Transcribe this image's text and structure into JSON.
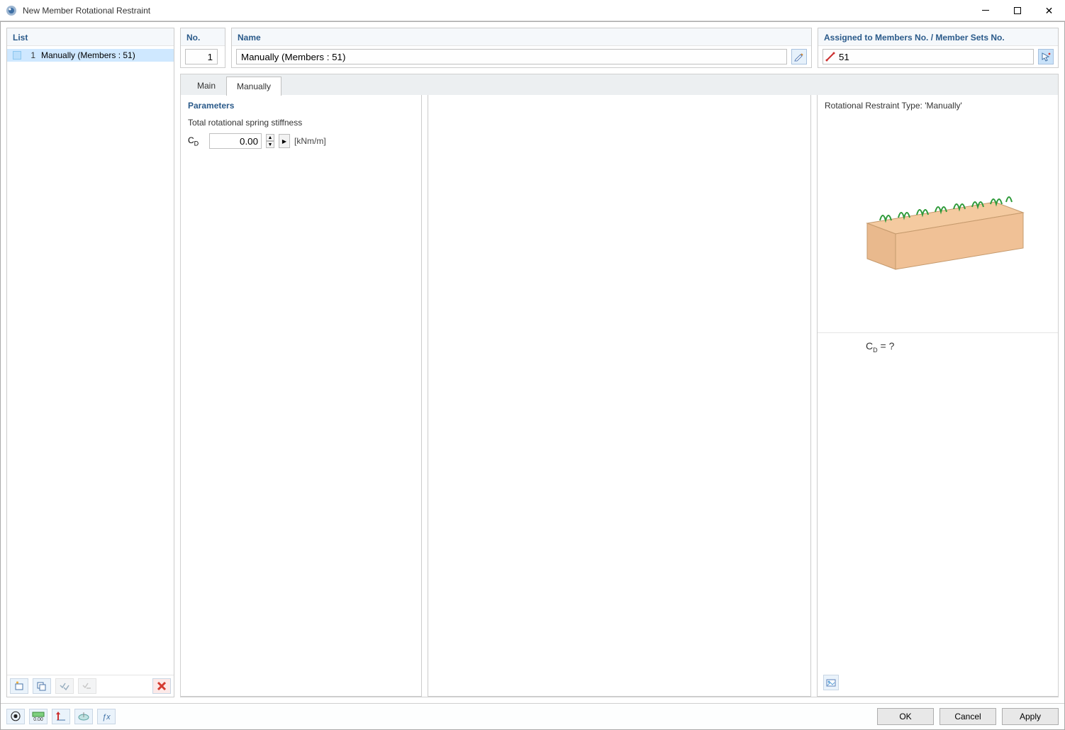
{
  "window": {
    "title": "New Member Rotational Restraint"
  },
  "list": {
    "header": "List",
    "items": [
      {
        "num": "1",
        "label": "Manually (Members : 51)"
      }
    ],
    "selected_index": 0
  },
  "top": {
    "no_label": "No.",
    "no_value": "1",
    "name_label": "Name",
    "name_value": "Manually (Members : 51)",
    "assigned_label": "Assigned to Members No. / Member Sets No.",
    "assigned_value": "51"
  },
  "tabs": {
    "main": "Main",
    "manually": "Manually",
    "active": "manually"
  },
  "params": {
    "header": "Parameters",
    "row1_label": "Total rotational spring stiffness",
    "symbol": "C",
    "symbol_sub": "D",
    "value": "0.00",
    "unit": "[kNm/m]"
  },
  "right_panel": {
    "header": "Rotational Restraint Type: 'Manually'",
    "caption_sym": "C",
    "caption_sub": "D",
    "caption_suffix": "  =  ?"
  },
  "buttons": {
    "ok": "OK",
    "cancel": "Cancel",
    "apply": "Apply"
  }
}
